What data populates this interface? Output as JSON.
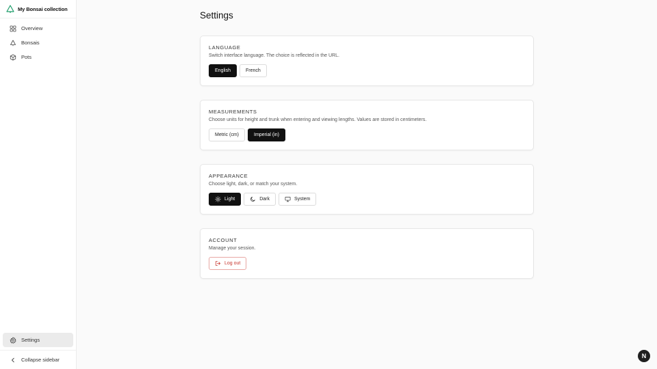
{
  "app": {
    "title": "My Bonsai collection",
    "accent_color": "#1f9d6b"
  },
  "sidebar": {
    "items": [
      {
        "label": "Overview",
        "icon": "grid-icon"
      },
      {
        "label": "Bonsais",
        "icon": "tree-icon"
      },
      {
        "label": "Pots",
        "icon": "box-icon"
      }
    ],
    "settings": {
      "label": "Settings",
      "icon": "gear-icon",
      "active": true
    },
    "collapse": {
      "label": "Collapse sidebar",
      "icon": "chevron-left-icon"
    }
  },
  "main": {
    "title": "Settings",
    "sections": {
      "language": {
        "heading": "Language",
        "description": "Switch interface language. The choice is reflected in the URL.",
        "options": [
          "English",
          "French"
        ],
        "selected": "English"
      },
      "measurements": {
        "heading": "Measurements",
        "description": "Choose units for height and trunk when entering and viewing lengths. Values are stored in centimeters.",
        "options": [
          "Metric (cm)",
          "Imperial (in)"
        ],
        "selected": "Imperial (in)"
      },
      "appearance": {
        "heading": "Appearance",
        "description": "Choose light, dark, or match your system.",
        "options": [
          "Light",
          "Dark",
          "System"
        ],
        "selected": "Light"
      },
      "account": {
        "heading": "Account",
        "description": "Manage your session.",
        "logout_label": "Log out",
        "danger_color": "#c8372f"
      }
    }
  },
  "fab": {
    "label": "N"
  }
}
